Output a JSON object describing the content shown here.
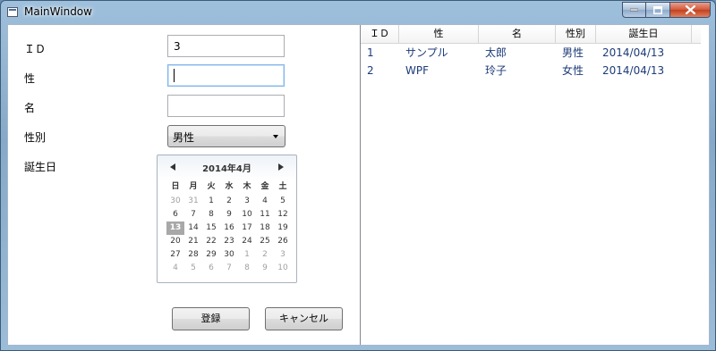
{
  "window": {
    "title": "MainWindow"
  },
  "form": {
    "id_label": "ＩＤ",
    "id_value": "3",
    "sei_label": "性",
    "sei_value": "",
    "mei_label": "名",
    "mei_value": "",
    "gender_label": "性別",
    "gender_value": "男性",
    "birthday_label": "誕生日",
    "register_button": "登録",
    "cancel_button": "キャンセル"
  },
  "calendar": {
    "title": "2014年4月",
    "weekdays": [
      "日",
      "月",
      "火",
      "水",
      "木",
      "金",
      "土"
    ],
    "weeks": [
      [
        "30",
        "31",
        "1",
        "2",
        "3",
        "4",
        "5"
      ],
      [
        "6",
        "7",
        "8",
        "9",
        "10",
        "11",
        "12"
      ],
      [
        "13",
        "14",
        "15",
        "16",
        "17",
        "18",
        "19"
      ],
      [
        "20",
        "21",
        "22",
        "23",
        "24",
        "25",
        "26"
      ],
      [
        "27",
        "28",
        "29",
        "30",
        "1",
        "2",
        "3"
      ],
      [
        "4",
        "5",
        "6",
        "7",
        "8",
        "9",
        "10"
      ]
    ],
    "today": "13"
  },
  "grid": {
    "headers": [
      "ＩＤ",
      "性",
      "名",
      "性別",
      "誕生日"
    ],
    "rows": [
      [
        "1",
        "サンプル",
        "太郎",
        "男性",
        "2014/04/13"
      ],
      [
        "2",
        "WPF",
        "玲子",
        "女性",
        "2014/04/13"
      ]
    ]
  }
}
